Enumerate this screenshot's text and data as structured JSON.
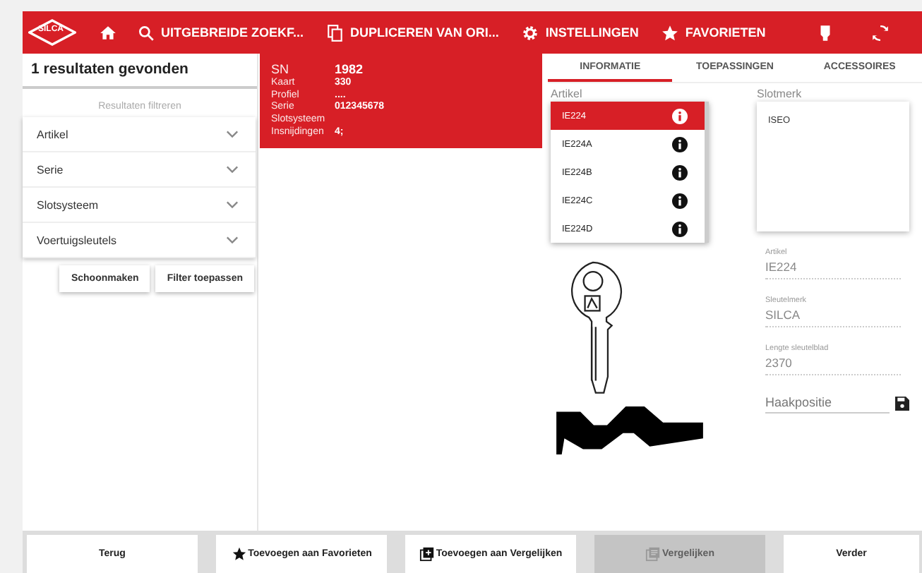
{
  "header": {
    "logo": "SILCA",
    "nav": [
      {
        "kind": "home"
      },
      {
        "kind": "search",
        "label": "UITGEBREIDE ZOEKF..."
      },
      {
        "kind": "duplicate",
        "label": "DUPLICEREN VAN ORI..."
      },
      {
        "kind": "settings",
        "label": "INSTELLINGEN"
      },
      {
        "kind": "favorites",
        "label": "FAVORIETEN"
      },
      {
        "kind": "key"
      },
      {
        "kind": "sync"
      }
    ]
  },
  "sidebar": {
    "results_title": "1 resultaten gevonden",
    "filter_label": "Resultaten filtreren",
    "filters": [
      {
        "label": "Artikel",
        "expanded": false
      },
      {
        "label": "Serie",
        "expanded": false
      },
      {
        "label": "Slotsysteem",
        "expanded": false
      },
      {
        "label": "Voertuigsleutels",
        "expanded": false
      }
    ],
    "buttons": [
      "Schoonmaken",
      "Filter toepassen"
    ]
  },
  "result_card": {
    "selected": true,
    "rows": [
      {
        "label": "SN",
        "value": "1982"
      },
      {
        "label": "Kaart",
        "value": "330"
      },
      {
        "label": "Profiel",
        "value": "...."
      },
      {
        "label": "Serie",
        "value": "012345678"
      },
      {
        "label": "Slotsysteem"
      },
      {
        "label": "Insnijdingen",
        "value": "4;"
      }
    ]
  },
  "tabs": [
    {
      "label": "INFORMATIE",
      "selected": true
    },
    {
      "label": "TOEPASSINGEN",
      "selected": false
    },
    {
      "label": "ACCESSOIRES",
      "selected": false
    }
  ],
  "artikel": {
    "label": "Artikel",
    "items": [
      {
        "label": "IE224",
        "selected": true
      },
      {
        "label": "IE224A",
        "selected": false
      },
      {
        "label": "IE224B",
        "selected": false
      },
      {
        "label": "IE224C",
        "selected": false
      },
      {
        "label": "IE224D",
        "selected": false
      }
    ]
  },
  "slotmerk": {
    "label": "Slotmerk",
    "items": [
      "ISEO"
    ]
  },
  "fields": [
    {
      "label": "Artikel",
      "value": "IE224"
    },
    {
      "label": "Sleutelmerk",
      "value": "SILCA"
    },
    {
      "label": "Lengte sleutelblad",
      "value": "2370"
    }
  ],
  "haakpositie": {
    "placeholder": "Haakpositie"
  },
  "bottom_buttons": [
    {
      "kind": "plain",
      "label": "Terug",
      "disabled": false
    },
    {
      "kind": "star",
      "label": "Toevoegen aan Favorieten",
      "disabled": false
    },
    {
      "kind": "add",
      "label": "Toevoegen aan Vergelijken",
      "disabled": false
    },
    {
      "kind": "compare",
      "label": "Vergelijken",
      "disabled": true
    },
    {
      "kind": "plain",
      "label": "Verder",
      "disabled": false
    }
  ]
}
